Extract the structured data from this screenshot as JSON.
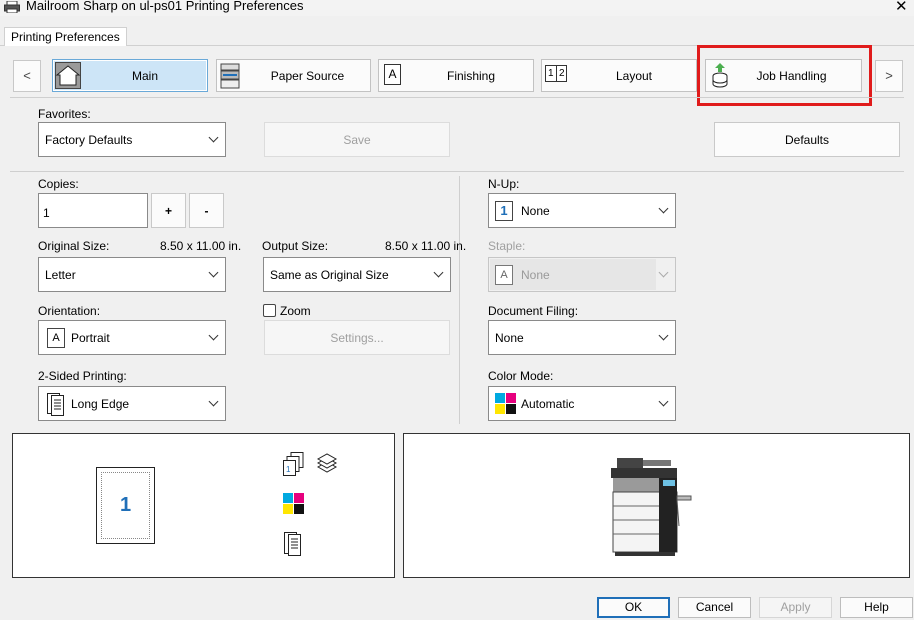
{
  "window": {
    "title": "Mailroom Sharp on ul-ps01 Printing Preferences",
    "close_glyph": "✕"
  },
  "tab_strip": {
    "active_tab": "Printing Preferences"
  },
  "nav": {
    "prev_glyph": "<",
    "next_glyph": ">",
    "tabs": [
      {
        "label": "Main",
        "icon": "home-icon"
      },
      {
        "label": "Paper Source",
        "icon": "printer-icon"
      },
      {
        "label": "Finishing",
        "icon": "finishing-icon"
      },
      {
        "label": "Layout",
        "icon": "layout-icon"
      },
      {
        "label": "Job Handling",
        "icon": "job-handling-icon"
      }
    ]
  },
  "favorites": {
    "label": "Favorites:",
    "value": "Factory Defaults",
    "save_label": "Save",
    "defaults_label": "Defaults"
  },
  "copies": {
    "label": "Copies:",
    "value": "1",
    "plus": "+",
    "minus": "-"
  },
  "original_size": {
    "label": "Original Size:",
    "dims": "8.50 x 11.00 in.",
    "value": "Letter"
  },
  "output_size": {
    "label": "Output Size:",
    "dims": "8.50 x 11.00 in.",
    "value": "Same as Original Size"
  },
  "orientation": {
    "label": "Orientation:",
    "value": "Portrait",
    "icon_letter": "A"
  },
  "zoom": {
    "label": "Zoom",
    "checked": false,
    "settings_label": "Settings..."
  },
  "two_sided": {
    "label": "2-Sided Printing:",
    "value": "Long Edge"
  },
  "nup": {
    "label": "N-Up:",
    "value": "None",
    "icon_number": "1"
  },
  "staple": {
    "label": "Staple:",
    "value": "None",
    "icon_letter": "A"
  },
  "document_filing": {
    "label": "Document Filing:",
    "value": "None"
  },
  "color_mode": {
    "label": "Color Mode:",
    "value": "Automatic"
  },
  "preview": {
    "page_number": "1"
  },
  "footer": {
    "ok": "OK",
    "cancel": "Cancel",
    "apply": "Apply",
    "help": "Help"
  },
  "colors": {
    "accent": "#1f6fb8",
    "highlight": "#e01b1b",
    "active_tab_bg": "#cde5f7"
  }
}
